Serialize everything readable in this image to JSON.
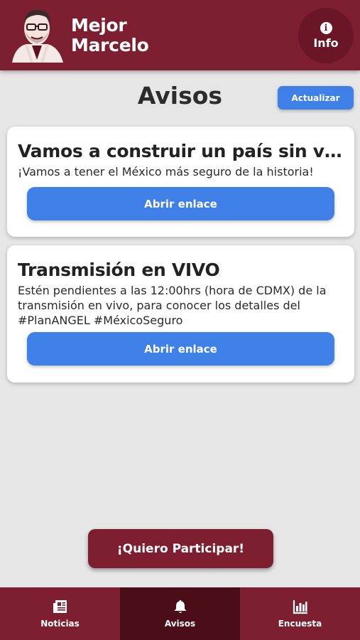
{
  "header": {
    "brand_line1": "Mejor",
    "brand_line2": "Marcelo",
    "info_label": "Info"
  },
  "page": {
    "title": "Avisos",
    "refresh_label": "Actualizar"
  },
  "notices": [
    {
      "title": "Vamos a construir un país sin vi...",
      "body": "¡Vamos a tener el México más seguro de la historia!",
      "button_label": "Abrir enlace"
    },
    {
      "title": "Transmisión en VIVO",
      "body": "Estén pendientes a las 12:00hrs (hora de CDMX) de la transmisión en vivo, para conocer los detalles del #PlanANGEL #MéxicoSeguro",
      "button_label": "Abrir enlace"
    }
  ],
  "participate_label": "¡Quiero Participar!",
  "nav": {
    "items": [
      {
        "label": "Noticias",
        "icon": "newspaper-icon"
      },
      {
        "label": "Avisos",
        "icon": "bell-icon",
        "active": true
      },
      {
        "label": "Encuesta",
        "icon": "bar-chart-icon"
      }
    ]
  },
  "colors": {
    "brand": "#7d1f30",
    "brand_dark": "#4b0d18",
    "accent_blue": "#3e7fe8",
    "background": "#e6e6e6"
  }
}
